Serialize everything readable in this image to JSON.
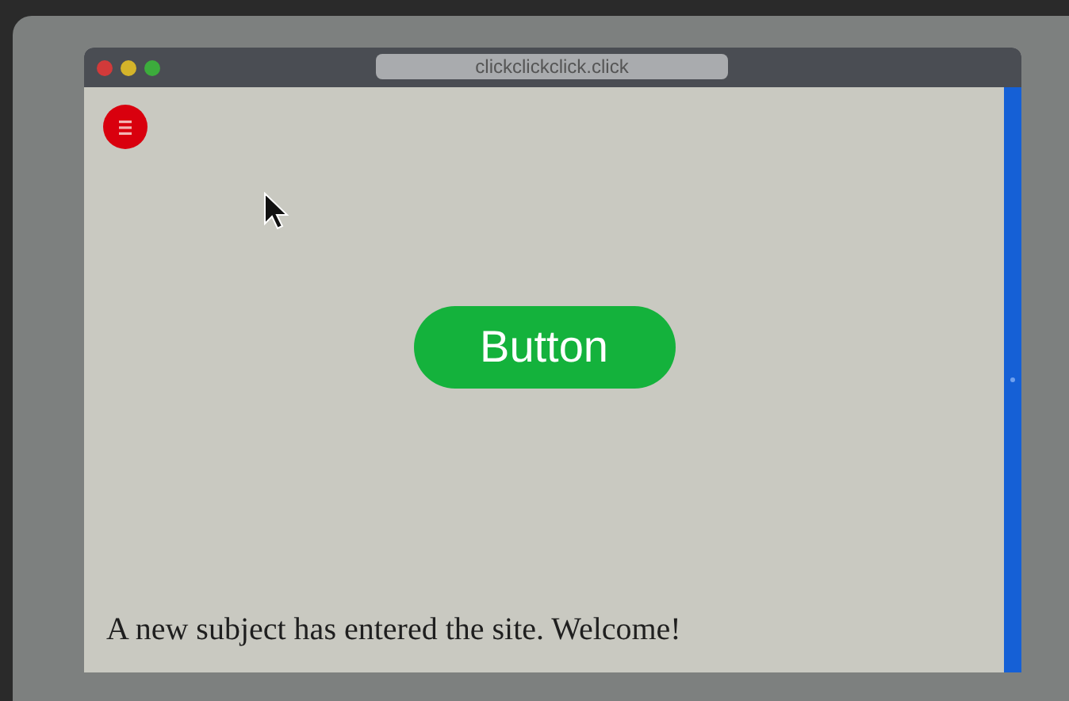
{
  "browser": {
    "address": "clickclickclick.click"
  },
  "page": {
    "button": "Button",
    "message": "A new subject has entered the site. Welcome!"
  }
}
